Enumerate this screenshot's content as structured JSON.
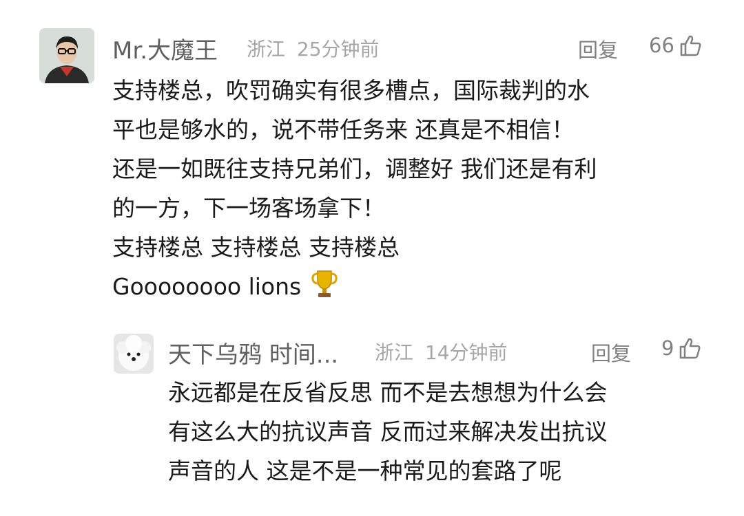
{
  "comments": [
    {
      "user": "Mr.大魔王",
      "location": "浙江",
      "time": "25分钟前",
      "reply_label": "回复",
      "likes": "66",
      "lines": [
        "支持楼总，吹罚确实有很多槽点，国际裁判的水",
        "平也是够水的，说不带任务来 还真是不相信！",
        "还是一如既往支持兄弟们，调整好 我们还是有利",
        "的一方，下一场客场拿下！",
        "支持楼总 支持楼总 支持楼总",
        "Goooooooo lions"
      ]
    }
  ],
  "reply": {
    "user": "天下乌鸦 时间...",
    "location": "浙江",
    "time": "14分钟前",
    "reply_label": "回复",
    "likes": "9",
    "lines": [
      "永远都是在反省反思 而不是去想想为什么会",
      "有这么大的抗议声音 反而过来解决发出抗议",
      "声音的人  这是不是一种常见的套路了呢"
    ]
  },
  "icons": {
    "like": "thumbs-up-icon",
    "emoji": "trophy-icon"
  },
  "colors": {
    "text": "#1a1a1a",
    "name": "#5f5f5f",
    "meta": "#a6a6a6",
    "action": "#808080"
  }
}
